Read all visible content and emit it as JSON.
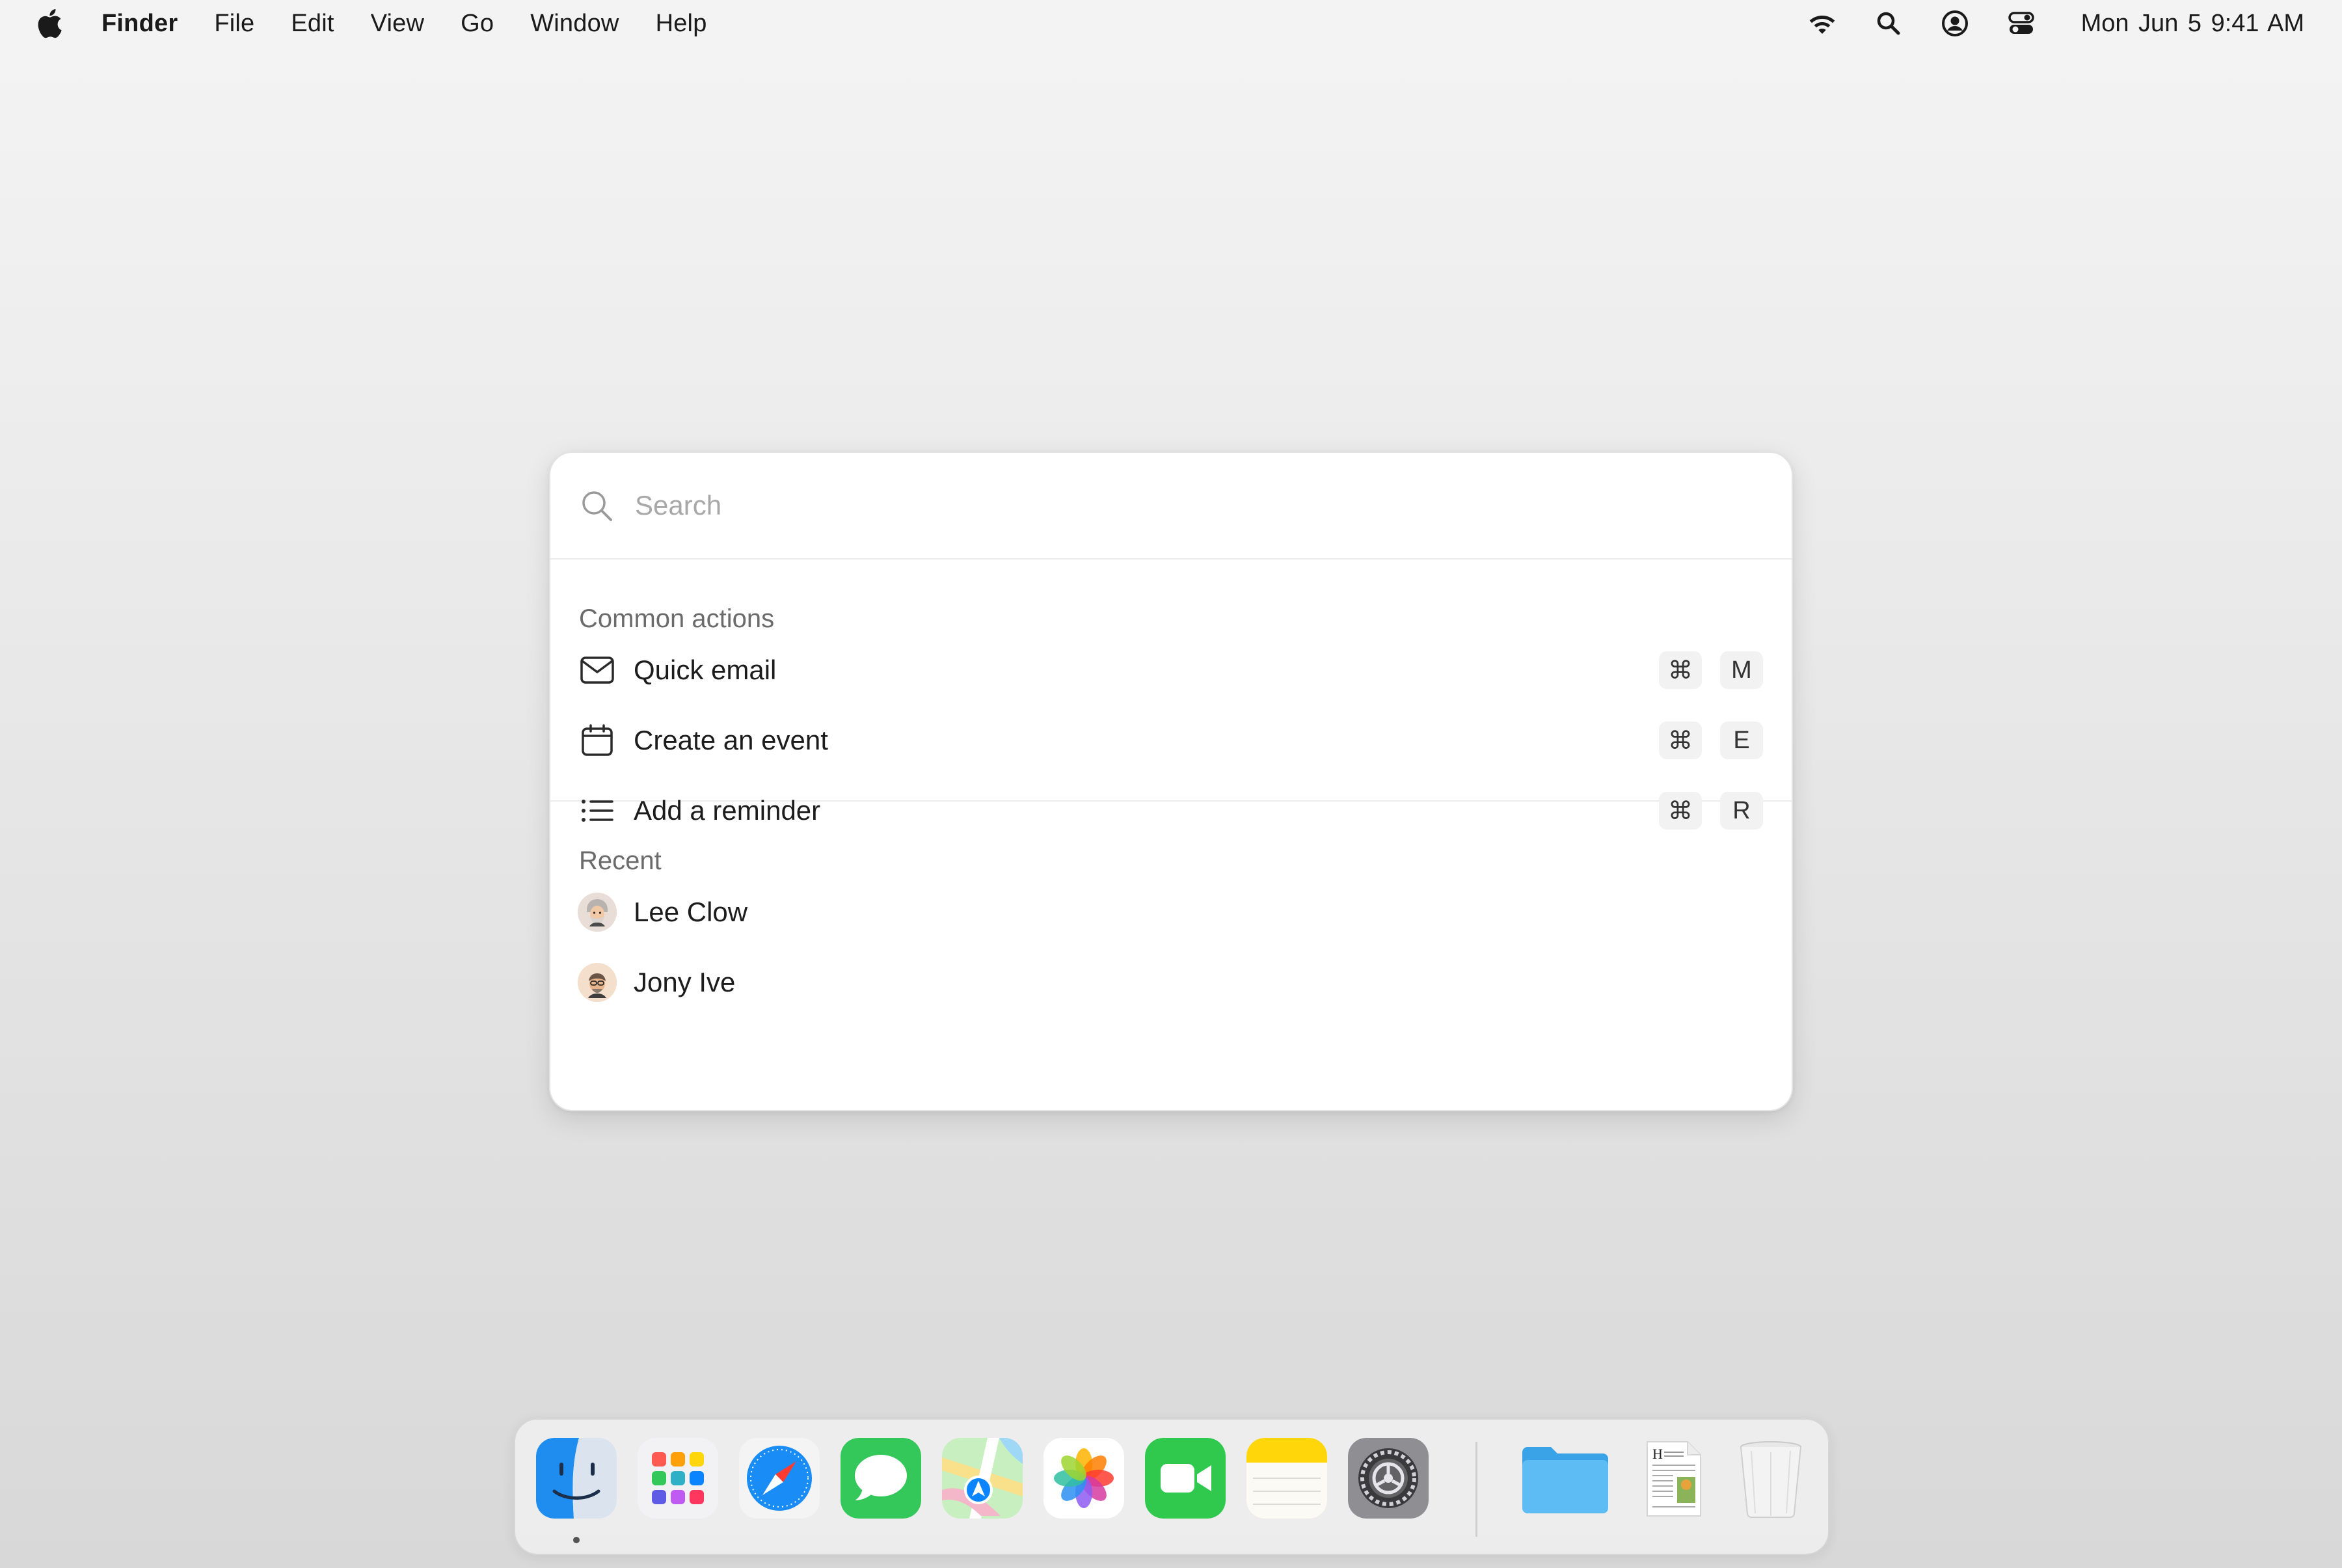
{
  "menubar": {
    "apple_icon": "apple-logo-icon",
    "app_name": "Finder",
    "items": [
      "File",
      "Edit",
      "View",
      "Go",
      "Window",
      "Help"
    ],
    "status_icons": [
      "wifi-icon",
      "spotlight-search-icon",
      "user-account-icon",
      "control-center-icon"
    ],
    "clock": "Mon Jun 5  9:41 AM"
  },
  "palette": {
    "search": {
      "placeholder": "Search",
      "value": ""
    },
    "common_actions": {
      "heading": "Common actions",
      "items": [
        {
          "label": "Quick email",
          "icon": "envelope-icon",
          "modifier": "⌘",
          "key": "M"
        },
        {
          "label": "Create an event",
          "icon": "calendar-icon",
          "modifier": "⌘",
          "key": "E"
        },
        {
          "label": "Add a reminder",
          "icon": "list-icon",
          "modifier": "⌘",
          "key": "R"
        }
      ]
    },
    "recent": {
      "heading": "Recent",
      "items": [
        {
          "label": "Lee Clow",
          "icon": "avatar-icon"
        },
        {
          "label": "Jony Ive",
          "icon": "avatar-icon"
        }
      ]
    }
  },
  "dock": {
    "apps": [
      "Finder",
      "Launchpad",
      "Safari",
      "Messages",
      "Maps",
      "Photos",
      "FaceTime",
      "Notes",
      "System Settings"
    ],
    "right": [
      "Downloads folder",
      "Document",
      "Trash"
    ],
    "running": [
      "Finder"
    ]
  },
  "colors": {
    "accent": "#0a84ff",
    "messages_green": "#34c759",
    "notes_yellow": "#ffd60a",
    "palette_bg": "#ffffff"
  }
}
